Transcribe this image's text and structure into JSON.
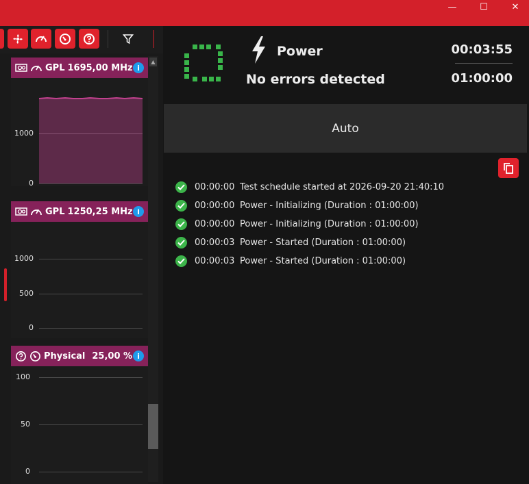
{
  "window": {
    "minimize_glyph": "—",
    "maximize_glyph": "☐",
    "close_glyph": "✕",
    "accent_color": "#d3202a"
  },
  "toolbar": {
    "buttons": [
      {
        "icon": "fan-icon"
      },
      {
        "icon": "gauge-icon"
      },
      {
        "icon": "speedometer-icon"
      },
      {
        "icon": "help-icon"
      }
    ],
    "filter_icon": "filter-icon"
  },
  "panels": [
    {
      "name": "GPL",
      "value": "1695,00 MHz",
      "icons": [
        "gpu-icon",
        "gauge-icon"
      ],
      "yticks": [
        "1000",
        "0"
      ],
      "header_color": "#86225a",
      "series_value_mhz": 1695
    },
    {
      "name": "GPL",
      "value": "1250,25 MHz",
      "icons": [
        "gpu-icon",
        "gauge-icon"
      ],
      "yticks": [
        "1000",
        "500",
        "0"
      ],
      "header_color": "#86225a"
    },
    {
      "name": "Physical",
      "value": "25,00 %",
      "icons": [
        "help-icon",
        "speedometer-icon"
      ],
      "yticks": [
        "100",
        "50",
        "0"
      ],
      "header_color": "#86225a"
    }
  ],
  "status": {
    "title": "Power",
    "message": "No errors detected",
    "elapsed": "00:03:55",
    "total": "01:00:00",
    "ok_color": "#39b54a"
  },
  "mode_button": "Auto",
  "log": [
    {
      "time": "00:00:00",
      "text": "Test schedule started at 2026-09-20 21:40:10"
    },
    {
      "time": "00:00:00",
      "text": "Power - Initializing (Duration : 01:00:00)"
    },
    {
      "time": "00:00:00",
      "text": "Power - Initializing (Duration : 01:00:00)"
    },
    {
      "time": "00:00:03",
      "text": "Power - Started (Duration : 01:00:00)"
    },
    {
      "time": "00:00:03",
      "text": "Power - Started (Duration : 01:00:00)"
    }
  ]
}
